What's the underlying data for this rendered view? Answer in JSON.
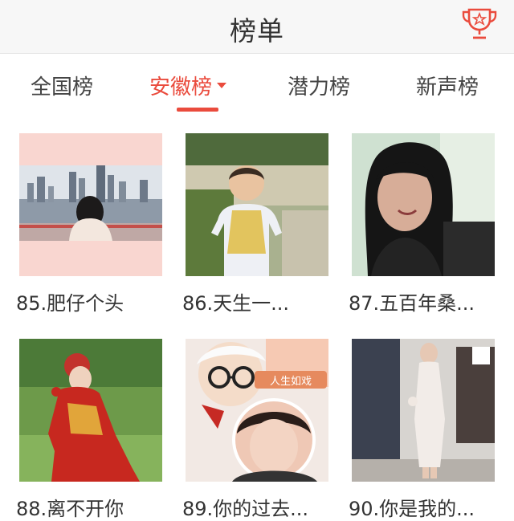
{
  "header": {
    "title": "榜单",
    "trophy_icon": "trophy-icon",
    "accent": "#ea4b3d"
  },
  "tabs": [
    {
      "label": "全国榜",
      "active": false
    },
    {
      "label": "安徽榜",
      "active": true
    },
    {
      "label": "潜力榜",
      "active": false
    },
    {
      "label": "新声榜",
      "active": false
    }
  ],
  "cards": [
    {
      "label": "85.肥仔个头"
    },
    {
      "label": "86.天生一..."
    },
    {
      "label": "87.五百年桑..."
    },
    {
      "label": "88.离不开你"
    },
    {
      "label": "89.你的过去...",
      "overlay_text": "人生如戏"
    },
    {
      "label": "90.你是我的..."
    }
  ]
}
